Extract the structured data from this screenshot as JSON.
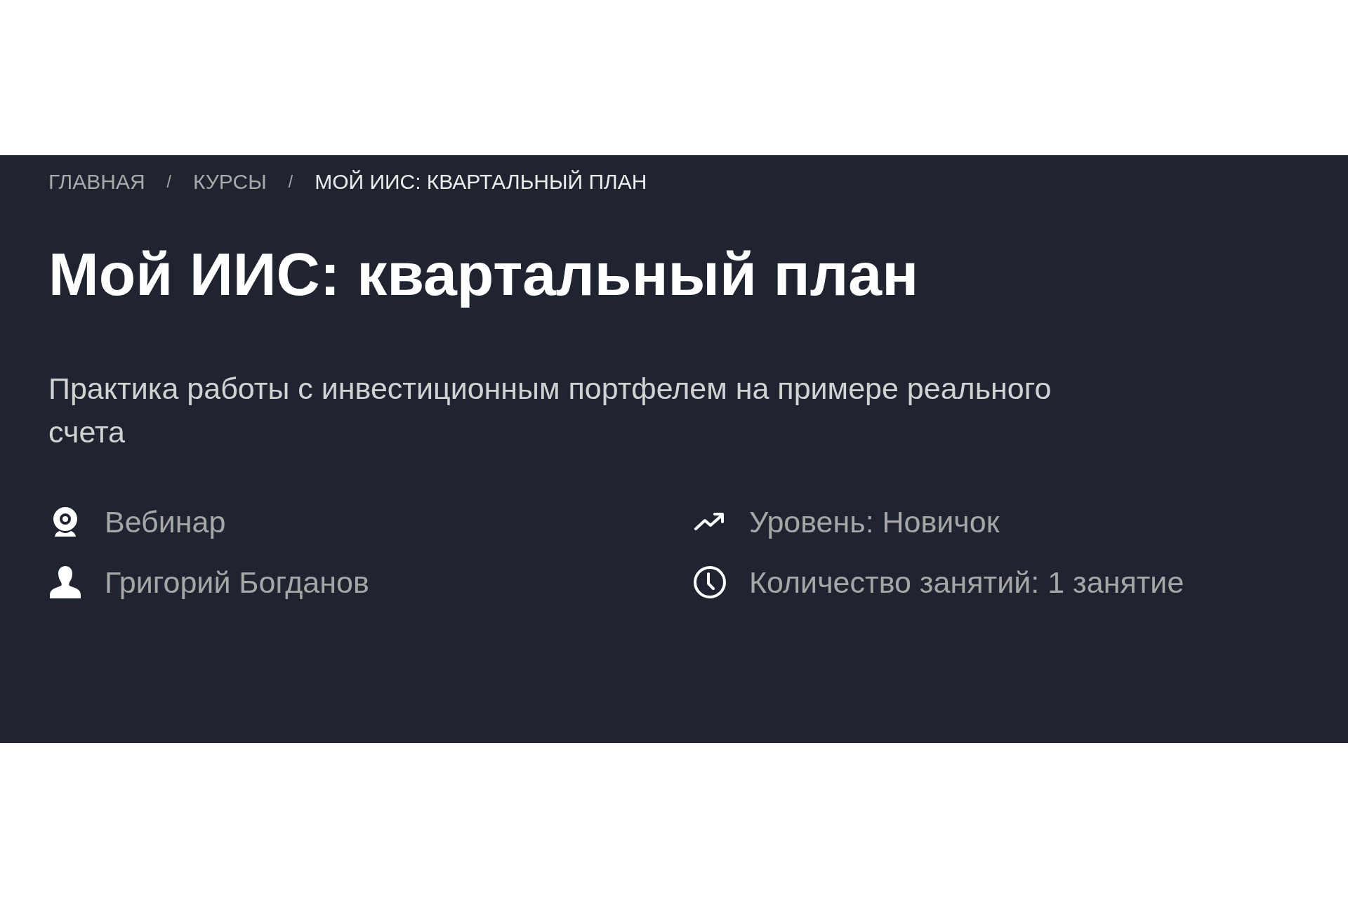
{
  "breadcrumb": [
    {
      "kind": "link",
      "text": "ГЛАВНАЯ"
    },
    {
      "kind": "separator",
      "text": "/"
    },
    {
      "kind": "link",
      "text": "КУРСЫ"
    },
    {
      "kind": "separator",
      "text": "/"
    },
    {
      "kind": "current",
      "text": "МОЙ ИИС: КВАРТАЛЬНЫЙ ПЛАН"
    }
  ],
  "title": "Мой ИИС: квартальный план",
  "description": "Практика работы с инвестиционным портфелем на примере реального счета",
  "meta": [
    {
      "kind": "format",
      "text": "Вебинар"
    },
    {
      "kind": "level",
      "text": "Уровень: Новичок"
    },
    {
      "kind": "author",
      "text": "Григорий Богданов"
    },
    {
      "kind": "lessons",
      "text": "Количество занятий: 1 занятие"
    }
  ]
}
